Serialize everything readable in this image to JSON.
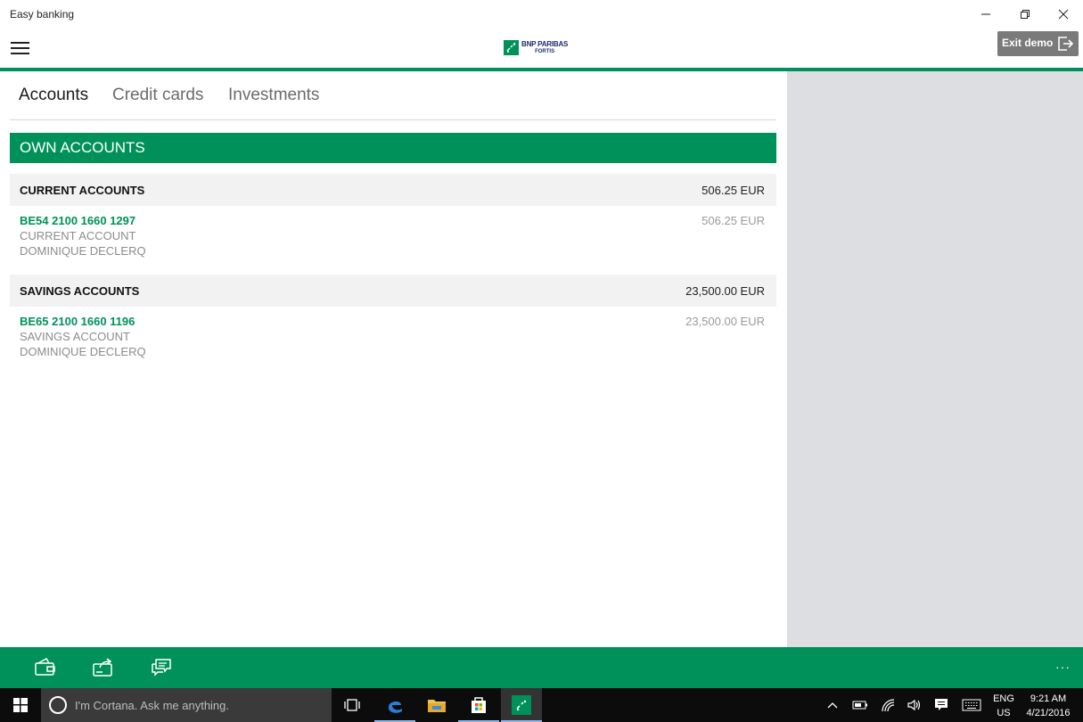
{
  "window": {
    "title": "Easy banking"
  },
  "header": {
    "logo_line1": "BNP PARIBAS",
    "logo_line2": "FORTIS",
    "exit_label": "Exit demo"
  },
  "tabs": [
    {
      "label": "Accounts",
      "active": true
    },
    {
      "label": "Credit cards",
      "active": false
    },
    {
      "label": "Investments",
      "active": false
    }
  ],
  "section": {
    "title": "OWN ACCOUNTS"
  },
  "groups": [
    {
      "label": "CURRENT ACCOUNTS",
      "amount": "506.25 EUR",
      "accounts": [
        {
          "number": "BE54 2100 1660 1297",
          "type": "CURRENT ACCOUNT",
          "holder": "DOMINIQUE DECLERQ",
          "amount": "506.25 EUR"
        }
      ]
    },
    {
      "label": "SAVINGS ACCOUNTS",
      "amount": "23,500.00 EUR",
      "accounts": [
        {
          "number": "BE65 2100 1660 1196",
          "type": "SAVINGS ACCOUNT",
          "holder": "DOMINIQUE DECLERQ",
          "amount": "23,500.00 EUR"
        }
      ]
    }
  ],
  "appbar": {
    "buttons": [
      "wallet-icon",
      "transfer-icon",
      "chat-icon"
    ],
    "more": "···"
  },
  "taskbar": {
    "search_placeholder": "I'm Cortana. Ask me anything.",
    "lang_line1": "ENG",
    "lang_line2": "US",
    "time": "9:21 AM",
    "date": "4/21/2016"
  },
  "colors": {
    "brand_green": "#00915a",
    "side_panel": "#dcdee2",
    "taskbar": "#0c0c0c"
  }
}
